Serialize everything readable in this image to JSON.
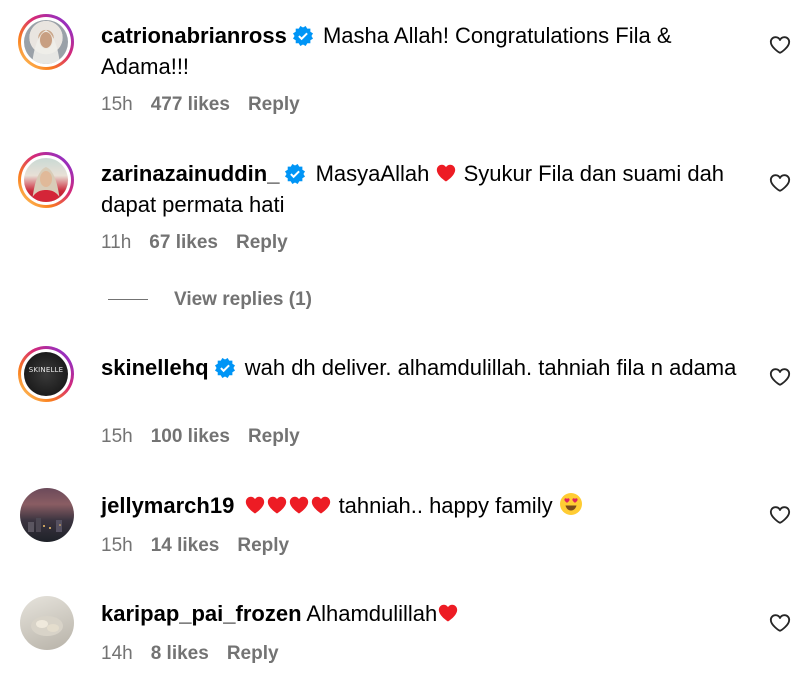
{
  "comments": [
    {
      "username": "catrionabrianross",
      "verified": true,
      "text": "Masha Allah! Congratulations Fila & Adama!!!",
      "time": "15h",
      "likes": "477 likes",
      "reply": "Reply",
      "avatar": "woman-hijab-photo"
    },
    {
      "username": "zarinazainuddin_",
      "verified": true,
      "text_before": "MasyaAllah",
      "text_after": "Syukur Fila dan suami dah dapat permata hati",
      "time": "11h",
      "likes": "67 likes",
      "reply": "Reply",
      "avatar": "woman-red-hijab-photo"
    },
    {
      "username": "skinellehq",
      "verified": true,
      "text": "wah dh deliver. alhamdulillah. tahniah fila n adama",
      "time": "15h",
      "likes": "100 likes",
      "reply": "Reply",
      "avatar": "skinelle-logo",
      "avatar_text": "SKINELLE"
    },
    {
      "username": "jellymarch19",
      "verified": false,
      "text": "tahniah.. happy family",
      "time": "15h",
      "likes": "14 likes",
      "reply": "Reply",
      "avatar": "sunset-city-photo"
    },
    {
      "username": "karipap_pai_frozen",
      "verified": false,
      "text": "Alhamdulillah",
      "time": "14h",
      "likes": "8 likes",
      "reply": "Reply",
      "avatar": "food-photo"
    }
  ],
  "view_replies": "View replies (1)",
  "colors": {
    "meta_gray": "#737373",
    "verified_blue": "#0095f6",
    "heart_red": "#ed1c24"
  }
}
